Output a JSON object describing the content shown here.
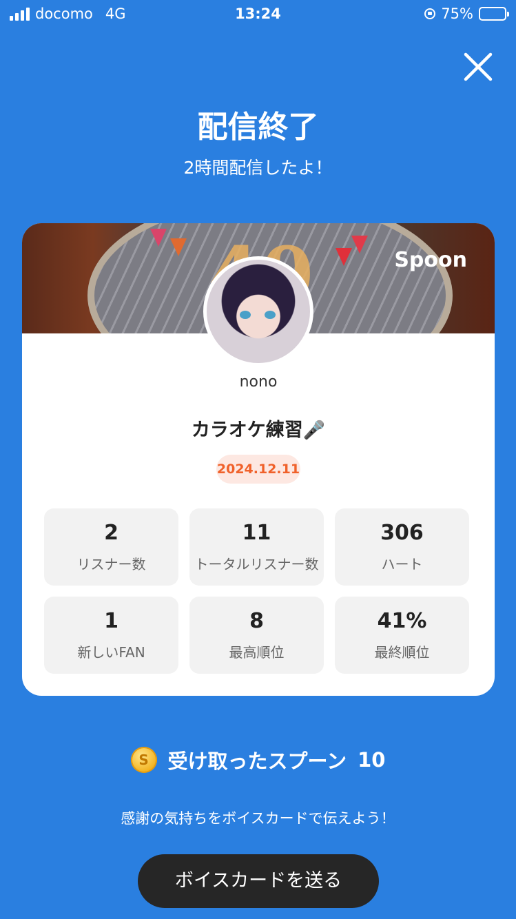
{
  "status_bar": {
    "carrier": "docomo",
    "network": "4G",
    "time": "13:24",
    "battery": "75%",
    "battery_level": 0.75
  },
  "header": {
    "title": "配信終了",
    "subtitle": "2時間配信したよ！"
  },
  "card": {
    "logo": "Spoon",
    "username": "nono",
    "live_title": "カラオケ練習",
    "title_icon": "microphone-icon",
    "date": "2024.12.11",
    "stats": [
      {
        "value": "2",
        "label": "リスナー数"
      },
      {
        "value": "11",
        "label": "トータルリスナー数"
      },
      {
        "value": "306",
        "label": "ハート"
      },
      {
        "value": "1",
        "label": "新しいFAN"
      },
      {
        "value": "8",
        "label": "最高順位"
      },
      {
        "value": "41%",
        "label": "最終順位"
      }
    ]
  },
  "spoons": {
    "coin_symbol": "S",
    "label": "受け取ったスプーン",
    "count": "10"
  },
  "thanks_text": "感謝の気持ちをボイスカードで伝えよう！",
  "send_button": "ボイスカードを送る",
  "colors": {
    "background": "#2a7fe0",
    "date_badge_bg": "#fde8e2",
    "date_badge_text": "#f0612a",
    "button_bg": "#262626"
  }
}
